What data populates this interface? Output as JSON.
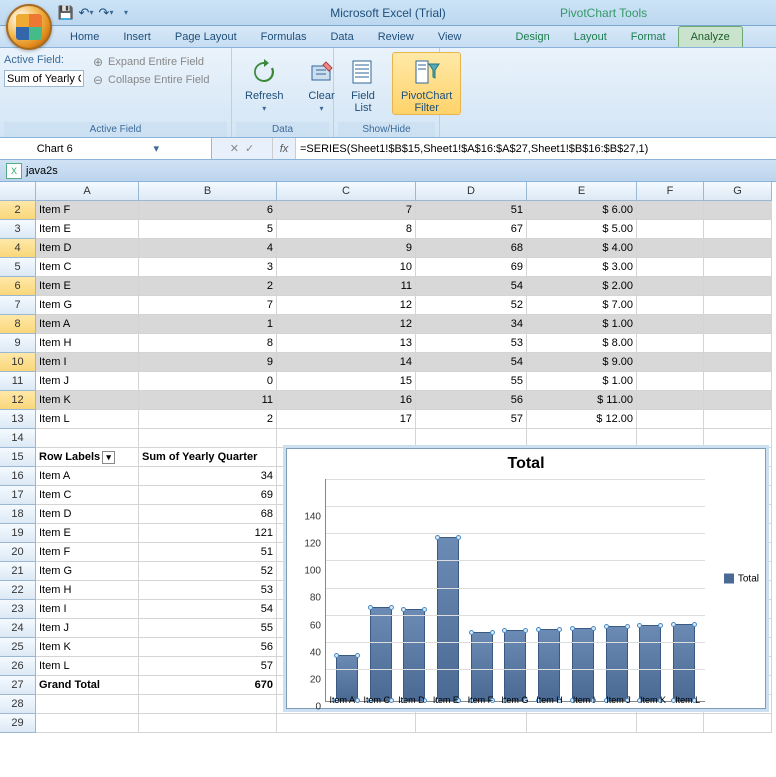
{
  "app_title": "Microsoft Excel (Trial)",
  "context_title": "PivotChart Tools",
  "tabs": [
    "Home",
    "Insert",
    "Page Layout",
    "Formulas",
    "Data",
    "Review",
    "View"
  ],
  "ctx_tabs": [
    "Design",
    "Layout",
    "Format",
    "Analyze"
  ],
  "active_tab": "Analyze",
  "ribbon": {
    "active_field_label": "Active Field:",
    "active_field_value": "Sum of Yearly Q",
    "expand": "Expand Entire Field",
    "collapse": "Collapse Entire Field",
    "grp_active": "Active Field",
    "refresh": "Refresh",
    "clear": "Clear",
    "grp_data": "Data",
    "field_list": "Field\nList",
    "pc_filter": "PivotChart\nFilter",
    "grp_show": "Show/Hide"
  },
  "namebox": "Chart 6",
  "formula": "=SERIES(Sheet1!$B$15,Sheet1!$A$16:$A$27,Sheet1!$B$16:$B$27,1)",
  "workbook": "java2s",
  "columns": [
    "A",
    "B",
    "C",
    "D",
    "E",
    "F",
    "G"
  ],
  "rows_top": [
    {
      "n": 2,
      "a": "Item F",
      "b": "6",
      "c": "7",
      "d": "51",
      "e": "$        6.00",
      "sel": true
    },
    {
      "n": 3,
      "a": "Item E",
      "b": "5",
      "c": "8",
      "d": "67",
      "e": "$        5.00",
      "sel": false
    },
    {
      "n": 4,
      "a": "Item D",
      "b": "4",
      "c": "9",
      "d": "68",
      "e": "$        4.00",
      "sel": true
    },
    {
      "n": 5,
      "a": "Item C",
      "b": "3",
      "c": "10",
      "d": "69",
      "e": "$        3.00",
      "sel": false
    },
    {
      "n": 6,
      "a": "Item E",
      "b": "2",
      "c": "11",
      "d": "54",
      "e": "$        2.00",
      "sel": true
    },
    {
      "n": 7,
      "a": "Item G",
      "b": "7",
      "c": "12",
      "d": "52",
      "e": "$        7.00",
      "sel": false
    },
    {
      "n": 8,
      "a": "Item A",
      "b": "1",
      "c": "12",
      "d": "34",
      "e": "$        1.00",
      "sel": true
    },
    {
      "n": 9,
      "a": "Item H",
      "b": "8",
      "c": "13",
      "d": "53",
      "e": "$        8.00",
      "sel": false
    },
    {
      "n": 10,
      "a": "Item I",
      "b": "9",
      "c": "14",
      "d": "54",
      "e": "$        9.00",
      "sel": true
    },
    {
      "n": 11,
      "a": "Item J",
      "b": "0",
      "c": "15",
      "d": "55",
      "e": "$        1.00",
      "sel": false
    },
    {
      "n": 12,
      "a": "Item K",
      "b": "11",
      "c": "16",
      "d": "56",
      "e": "$      11.00",
      "sel": true
    },
    {
      "n": 13,
      "a": "Item L",
      "b": "2",
      "c": "17",
      "d": "57",
      "e": "$      12.00",
      "sel": false
    }
  ],
  "pivot_header_row": 15,
  "pivot_headers": {
    "a": "Row Labels",
    "b": "Sum of Yearly Quarter"
  },
  "pivot_rows": [
    {
      "n": 16,
      "a": "Item A",
      "b": "34"
    },
    {
      "n": 17,
      "a": "Item C",
      "b": "69"
    },
    {
      "n": 18,
      "a": "Item D",
      "b": "68"
    },
    {
      "n": 19,
      "a": "Item E",
      "b": "121"
    },
    {
      "n": 20,
      "a": "Item F",
      "b": "51"
    },
    {
      "n": 21,
      "a": "Item G",
      "b": "52"
    },
    {
      "n": 22,
      "a": "Item H",
      "b": "53"
    },
    {
      "n": 23,
      "a": "Item I",
      "b": "54"
    },
    {
      "n": 24,
      "a": "Item J",
      "b": "55"
    },
    {
      "n": 25,
      "a": "Item K",
      "b": "56"
    },
    {
      "n": 26,
      "a": "Item L",
      "b": "57"
    }
  ],
  "grand_total": {
    "n": 27,
    "a": "Grand Total",
    "b": "670"
  },
  "empty_rows": [
    14,
    28,
    29
  ],
  "chart_data": {
    "type": "bar",
    "title": "Total",
    "categories": [
      "Item A",
      "Item C",
      "Item D",
      "Item E",
      "Item F",
      "Item G",
      "Item H",
      "Item I",
      "Item J",
      "Item K",
      "Item L"
    ],
    "values": [
      34,
      69,
      68,
      121,
      51,
      52,
      53,
      54,
      55,
      56,
      57
    ],
    "series_name": "Total",
    "ylim": [
      0,
      140
    ],
    "yticks": [
      0,
      20,
      40,
      60,
      80,
      100,
      120,
      140
    ],
    "xlabel": "",
    "ylabel": ""
  }
}
